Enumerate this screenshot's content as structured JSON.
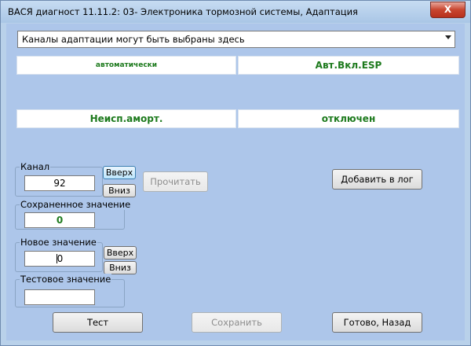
{
  "window": {
    "title": "ВАСЯ диагност 11.11.2: 03- Электроника тормозной системы, Адаптация",
    "close_symbol": "X"
  },
  "combo": {
    "selected": "Каналы адаптации могут быть выбраны здесь"
  },
  "values": {
    "row1_left": "автоматически",
    "row1_right": "Авт.Вкл.ESP",
    "row2_left": "Неисп.аморт.",
    "row2_right": "отключен"
  },
  "channel": {
    "label": "Канал",
    "value": "92",
    "up": "Вверх",
    "down": "Вниз",
    "read": "Прочитать"
  },
  "saved": {
    "label": "Сохраненное значение",
    "value": "0"
  },
  "new_value": {
    "label": "Новое значение",
    "value": "0",
    "up": "Вверх",
    "down": "Вниз"
  },
  "test_value": {
    "label": "Тестовое значение",
    "value": ""
  },
  "buttons": {
    "add_log": "Добавить в лог",
    "test": "Тест",
    "save": "Сохранить",
    "done": "Готово, Назад"
  }
}
